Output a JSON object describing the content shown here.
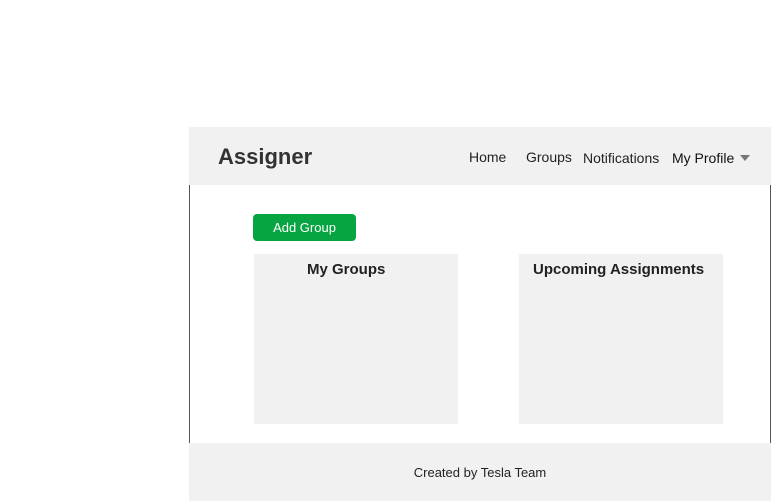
{
  "header": {
    "brand": "Assigner",
    "nav": {
      "home": "Home",
      "groups": "Groups",
      "notifications": "Notifications",
      "profile": "My Profile"
    },
    "profile_icon": "caret-down-icon"
  },
  "main": {
    "add_group_label": "Add Group",
    "panels": [
      {
        "title": "My Groups"
      },
      {
        "title": "Upcoming Assignments"
      }
    ]
  },
  "footer": {
    "text": "Created by Tesla Team"
  },
  "colors": {
    "header_bg": "#f1f1f1",
    "primary_button": "#06a541",
    "panel_bg": "#f1f1f1"
  }
}
